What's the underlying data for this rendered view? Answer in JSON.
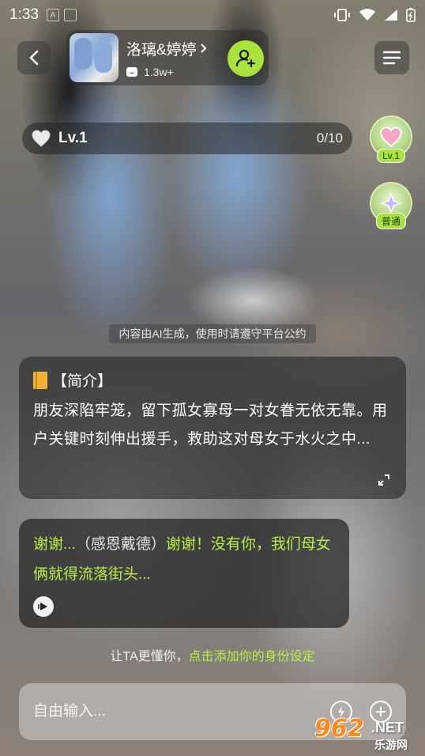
{
  "status_bar": {
    "time": "1:33"
  },
  "header": {
    "character_name": "洛璃&婷婷",
    "chat_count": "1.3w+"
  },
  "level": {
    "label": "Lv.1",
    "progress": "0/10"
  },
  "side_badges": [
    {
      "icon": "heart-icon",
      "tag": "Lv.1"
    },
    {
      "icon": "sparkle-star-icon",
      "tag": "普通"
    }
  ],
  "notice": "内容由AI生成，使用时请遵守平台公约",
  "intro": {
    "title": "【简介】",
    "text": "朋友深陷牢笼，留下孤女寡母一对女眷无依无靠。用户关键时刻伸出援手，救助这对母女于水火之中..."
  },
  "message": {
    "action": "（感恩戴德）",
    "part1": "谢谢...",
    "part2": "谢谢！没有你，我们母女俩就得流落街头..."
  },
  "identity_hint": {
    "prefix": "让TA更懂你，",
    "link": "点击添加你的身份设定"
  },
  "input": {
    "placeholder": "自由输入..."
  },
  "watermark": {
    "number": "962",
    "domain": ".NET",
    "site": "乐游网"
  },
  "colors": {
    "accent_green": "#a8e23a",
    "message_text": "#b6f046"
  }
}
